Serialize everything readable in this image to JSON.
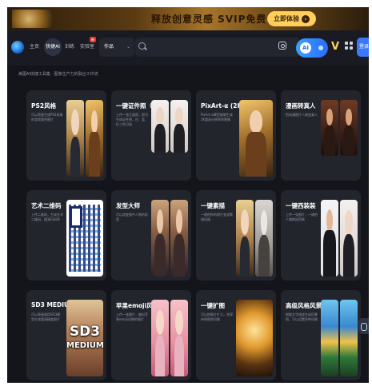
{
  "banner": {
    "text": "释放创意灵感  SVIP免费试用!",
    "cta": "立即体验",
    "cta_arrow": "›"
  },
  "nav": {
    "items": [
      "主页",
      "快捷AI",
      "训练",
      "实验室"
    ],
    "new_badge": "新",
    "dropdown_value": "作品",
    "dropdown_chevron": "⌄",
    "search_placeholder": "",
    "ai_button_face": "AI",
    "login_label": "登录",
    "brand_mark": "V"
  },
  "subtitle": "美图AI快捷工具集 · 图像生产力的融合工作流",
  "cards": [
    {
      "title": "PS2风格",
      "desc": "可以直接生成PS2风格的游戏角色图片",
      "images": [
        "tile-blond",
        "tile-gold"
      ]
    },
    {
      "title": "一键证件照（女...",
      "desc": "上传一张正面照，即可生成证件照，白、蓝、红三色可选",
      "images": [
        "tile-white",
        "tile-white"
      ]
    },
    {
      "title": "PixArt-α (2K图...",
      "desc": "PixArt-α模型能够生成2K超高分辨率的图像",
      "images": [
        "tile-gold"
      ]
    },
    {
      "title": "漫画转真人",
      "desc": "把动漫图片人物变真人",
      "images": [
        "tile-oil",
        "tile-oil"
      ]
    },
    {
      "title": "艺术二维码",
      "desc": "上传二维码，生成艺术二维码，提高扫码率",
      "images": [
        "tile-qr"
      ]
    },
    {
      "title": "发型大师",
      "desc": "可以改变图中人物的发型",
      "images": [
        "tile-person",
        "tile-person"
      ]
    },
    {
      "title": "一键素描",
      "desc": "一键把你的照片变成素描风格",
      "images": [
        "tile-blond",
        "tile-sketch"
      ]
    },
    {
      "title": "一键西装装",
      "desc": "上传一张图片，一键把人物换成西装",
      "images": [
        "tile-suit",
        "tile-white"
      ]
    },
    {
      "title": "SD3 MEDIUM",
      "desc": "可以直接调用SD3模型生成超高精度图片",
      "images": [
        "tile-sd3"
      ],
      "sd3_line1": "SD3",
      "sd3_line2": "MEDIUM"
    },
    {
      "title": "苹果emoji风格",
      "desc": "上传一张图片，输出苹果emoji风格的图片",
      "images": [
        "tile-pink",
        "tile-pink"
      ]
    },
    {
      "title": "一键扩图",
      "desc": "可以把图片扩大，并保持原图的风格",
      "images": [
        "tile-golden-scene"
      ]
    },
    {
      "title": "高级风格风景照",
      "desc": "根据文字描述生成风景照，可以设置多种风格",
      "images": [
        "tile-landscape",
        "tile-landscape"
      ]
    }
  ]
}
